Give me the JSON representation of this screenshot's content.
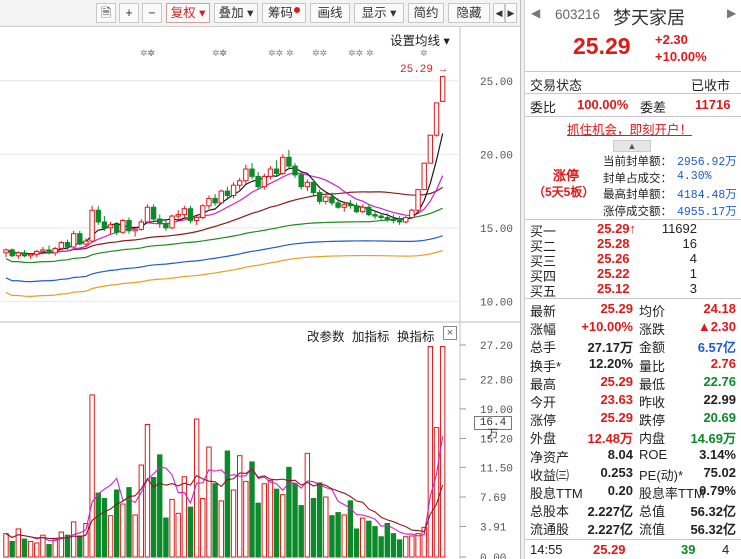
{
  "toolbar": {
    "buttons": [
      "复权 ▾",
      "叠加 ▾",
      "筹码",
      "画线",
      "显示 ▾",
      "简约",
      "隐藏"
    ],
    "icon_buttons": [
      "🗎",
      "+",
      "−"
    ]
  },
  "chart_header": {
    "ma_setting": "设置均线 ▾",
    "markers": [
      "✲✲",
      "✲",
      "✲✲",
      "✲",
      "✲✲",
      "✲",
      "✲✲",
      "✲✲",
      "✲",
      "✲"
    ],
    "price_tag": "25.29 →"
  },
  "volume_controls": {
    "labels": [
      "改参数",
      "加指标",
      "换指标"
    ],
    "close": "×",
    "current_volume_label": "16.4万"
  },
  "colors": {
    "up": "#e01818",
    "down": "#0a8a28",
    "ma1": "#1a1a1a",
    "ma2": "#cc22cc",
    "ma3": "#8b1a1a",
    "ma4": "#1f8a1f",
    "ma5": "#1f5bd0",
    "ma6": "#e8a020"
  },
  "chart_data": [
    {
      "type": "candlestick",
      "ylim": [
        8.8,
        27.3
      ],
      "yticks": [
        "25.00",
        "20.00",
        "15.00",
        "10.00"
      ],
      "ohlc": [
        [
          13.3,
          13.6,
          13.0,
          13.5
        ],
        [
          13.5,
          13.6,
          13.0,
          13.1
        ],
        [
          13.1,
          13.4,
          12.9,
          13.3
        ],
        [
          13.3,
          13.5,
          13.0,
          13.1
        ],
        [
          13.1,
          13.3,
          12.9,
          13.2
        ],
        [
          13.2,
          13.5,
          13.0,
          13.4
        ],
        [
          13.4,
          13.7,
          13.2,
          13.5
        ],
        [
          13.5,
          13.8,
          13.2,
          13.3
        ],
        [
          13.3,
          13.7,
          13.1,
          13.6
        ],
        [
          13.6,
          14.1,
          13.5,
          14.0
        ],
        [
          14.0,
          14.2,
          13.5,
          13.7
        ],
        [
          13.7,
          14.8,
          13.6,
          14.6
        ],
        [
          14.6,
          14.8,
          13.8,
          13.9
        ],
        [
          13.9,
          14.3,
          13.7,
          14.1
        ],
        [
          14.1,
          16.5,
          14.0,
          16.2
        ],
        [
          16.2,
          16.5,
          15.2,
          15.4
        ],
        [
          15.4,
          15.8,
          14.8,
          15.0
        ],
        [
          15.0,
          15.4,
          14.6,
          15.2
        ],
        [
          15.2,
          15.4,
          14.5,
          14.7
        ],
        [
          14.7,
          15.6,
          14.6,
          15.5
        ],
        [
          15.5,
          15.7,
          14.6,
          14.8
        ],
        [
          14.8,
          15.1,
          14.4,
          14.9
        ],
        [
          14.9,
          15.6,
          14.8,
          15.4
        ],
        [
          15.4,
          16.6,
          15.3,
          16.4
        ],
        [
          16.4,
          16.6,
          15.4,
          15.6
        ],
        [
          15.6,
          15.9,
          15.0,
          15.3
        ],
        [
          15.3,
          15.5,
          14.8,
          15.0
        ],
        [
          15.0,
          15.9,
          14.9,
          15.8
        ],
        [
          15.8,
          16.2,
          15.5,
          15.9
        ],
        [
          15.9,
          16.5,
          15.6,
          16.3
        ],
        [
          16.3,
          16.5,
          15.3,
          15.5
        ],
        [
          15.5,
          15.8,
          15.2,
          15.7
        ],
        [
          15.7,
          16.6,
          15.6,
          16.5
        ],
        [
          16.5,
          17.2,
          16.3,
          17.0
        ],
        [
          17.0,
          17.3,
          16.5,
          16.7
        ],
        [
          16.7,
          17.6,
          16.6,
          17.5
        ],
        [
          17.5,
          17.8,
          16.9,
          17.2
        ],
        [
          17.2,
          18.1,
          17.0,
          17.9
        ],
        [
          17.9,
          18.4,
          17.6,
          18.2
        ],
        [
          18.2,
          19.3,
          18.0,
          19.0
        ],
        [
          19.0,
          19.4,
          18.3,
          18.5
        ],
        [
          18.5,
          18.8,
          17.6,
          17.8
        ],
        [
          17.8,
          18.7,
          17.6,
          18.5
        ],
        [
          18.5,
          19.2,
          18.3,
          19.0
        ],
        [
          19.0,
          19.6,
          18.5,
          18.7
        ],
        [
          18.7,
          20.0,
          18.6,
          19.8
        ],
        [
          19.8,
          20.3,
          19.0,
          19.2
        ],
        [
          19.2,
          19.4,
          18.4,
          18.6
        ],
        [
          18.6,
          18.8,
          17.6,
          17.8
        ],
        [
          17.8,
          18.3,
          17.5,
          18.1
        ],
        [
          18.1,
          18.3,
          17.2,
          17.4
        ],
        [
          17.4,
          17.6,
          16.6,
          16.8
        ],
        [
          16.8,
          17.3,
          16.6,
          17.1
        ],
        [
          17.1,
          17.4,
          16.5,
          16.7
        ],
        [
          16.7,
          17.0,
          16.3,
          16.4
        ],
        [
          16.4,
          16.8,
          16.1,
          16.6
        ],
        [
          16.6,
          16.9,
          16.3,
          16.5
        ],
        [
          16.5,
          16.7,
          16.0,
          16.1
        ],
        [
          16.1,
          16.6,
          16.0,
          16.4
        ],
        [
          16.4,
          16.6,
          15.8,
          15.9
        ],
        [
          15.9,
          16.2,
          15.6,
          15.8
        ],
        [
          15.8,
          16.0,
          15.5,
          15.7
        ],
        [
          15.7,
          16.0,
          15.4,
          15.6
        ],
        [
          15.6,
          15.9,
          15.3,
          15.5
        ],
        [
          15.5,
          15.8,
          15.2,
          15.4
        ],
        [
          15.4,
          15.8,
          15.3,
          15.7
        ],
        [
          15.7,
          16.3,
          15.6,
          16.2
        ],
        [
          16.2,
          17.6,
          16.1,
          17.6
        ],
        [
          17.6,
          19.4,
          17.6,
          19.4
        ],
        [
          19.4,
          21.3,
          19.4,
          21.3
        ],
        [
          21.3,
          23.5,
          21.2,
          23.5
        ],
        [
          23.6,
          25.3,
          23.6,
          25.3
        ]
      ]
    },
    {
      "type": "bar",
      "ylim": [
        0,
        27.2
      ],
      "yticks": [
        "27.20",
        "22.80",
        "19.00",
        "15.20",
        "11.50",
        "7.69",
        "3.91",
        "0.00"
      ],
      "values": [
        3.0,
        2.0,
        3.6,
        2.3,
        2.0,
        1.8,
        2.8,
        1.6,
        2.3,
        3.2,
        2.8,
        4.5,
        2.7,
        4.3,
        20.8,
        8.2,
        7.5,
        5.3,
        8.6,
        6.8,
        8.9,
        5.4,
        11.8,
        17.0,
        10.2,
        13.1,
        5.0,
        7.4,
        5.6,
        10.3,
        6.4,
        17.7,
        7.5,
        14.1,
        9.4,
        7.2,
        13.6,
        8.6,
        13.0,
        9.7,
        12.2,
        6.9,
        9.4,
        9.8,
        8.7,
        8.0,
        11.5,
        9.4,
        6.6,
        13.3,
        7.5,
        9.5,
        7.7,
        5.3,
        5.7,
        5.4,
        7.2,
        3.6,
        5.0,
        4.6,
        3.9,
        2.6,
        4.3,
        3.0,
        2.2,
        2.6,
        2.7,
        3.0,
        3.8,
        27.0,
        16.6,
        27.0
      ]
    }
  ],
  "quote": {
    "code": "603216",
    "name": "梦天家居",
    "price": "25.29",
    "change": "+2.30",
    "pct": "+10.00%",
    "trade_status_label": "交易状态",
    "trade_status": "已收市",
    "weibi_label": "委比",
    "weibi": "100.00%",
    "weicha_label": "委差",
    "weicha": "11716",
    "promo": "抓住机会，即刻开户！",
    "limit_title": "涨停",
    "limit_sub": "（5天5板）",
    "limit_stats": [
      {
        "label": "当前封单额：",
        "value": "2956.92万"
      },
      {
        "label": "封单占成交：",
        "value": "4.30%"
      },
      {
        "label": "最高封单额：",
        "value": "4184.48万"
      },
      {
        "label": "涨停成交额：",
        "value": "4955.17万"
      }
    ],
    "bids": [
      {
        "label": "买一",
        "price": "25.29↑",
        "vol": "11692"
      },
      {
        "label": "买二",
        "price": "25.28",
        "vol": "16"
      },
      {
        "label": "买三",
        "price": "25.26",
        "vol": "4"
      },
      {
        "label": "买四",
        "price": "25.22",
        "vol": "1"
      },
      {
        "label": "买五",
        "price": "25.12",
        "vol": "3"
      }
    ],
    "stats": [
      {
        "l1": "最新",
        "v1": "25.29",
        "c1": "red",
        "l2": "均价",
        "v2": "24.18",
        "c2": "red"
      },
      {
        "l1": "涨幅",
        "v1": "+10.00%",
        "c1": "red",
        "l2": "涨跌",
        "v2": "▲2.30",
        "c2": "red"
      },
      {
        "l1": "总手",
        "v1": "27.17万",
        "c1": "blk",
        "l2": "金额",
        "v2": "6.57亿",
        "c2": "blue"
      },
      {
        "l1": "换手*",
        "v1": "12.20%",
        "c1": "blk",
        "l2": "量比",
        "v2": "2.76",
        "c2": "red"
      },
      {
        "l1": "最高",
        "v1": "25.29",
        "c1": "red",
        "l2": "最低",
        "v2": "22.76",
        "c2": "green"
      },
      {
        "l1": "今开",
        "v1": "23.63",
        "c1": "red",
        "l2": "昨收",
        "v2": "22.99",
        "c2": "blk"
      },
      {
        "l1": "涨停",
        "v1": "25.29",
        "c1": "red",
        "l2": "跌停",
        "v2": "20.69",
        "c2": "green"
      },
      {
        "l1": "外盘",
        "v1": "12.48万",
        "c1": "red",
        "l2": "内盘",
        "v2": "14.69万",
        "c2": "green"
      },
      {
        "l1": "净资产",
        "v1": "8.04",
        "c1": "blk",
        "l2": "ROE",
        "v2": "3.14%",
        "c2": "blk"
      },
      {
        "l1": "收益㈢",
        "v1": "0.253",
        "c1": "blk",
        "l2": "PE(动)*",
        "v2": "75.02",
        "c2": "blk"
      },
      {
        "l1": "股息TTM",
        "v1": "0.20",
        "c1": "blk",
        "l2": "股息率TTM",
        "v2": "0.79%",
        "c2": "blk"
      },
      {
        "l1": "总股本",
        "v1": "2.227亿",
        "c1": "blk",
        "l2": "总值",
        "v2": "56.32亿",
        "c2": "blk"
      },
      {
        "l1": "流通股",
        "v1": "2.227亿",
        "c1": "blk",
        "l2": "流值",
        "v2": "56.32亿",
        "c2": "blk"
      }
    ],
    "tick": {
      "time": "14:55",
      "price": "25.29",
      "vol": "39",
      "num": "4"
    }
  }
}
